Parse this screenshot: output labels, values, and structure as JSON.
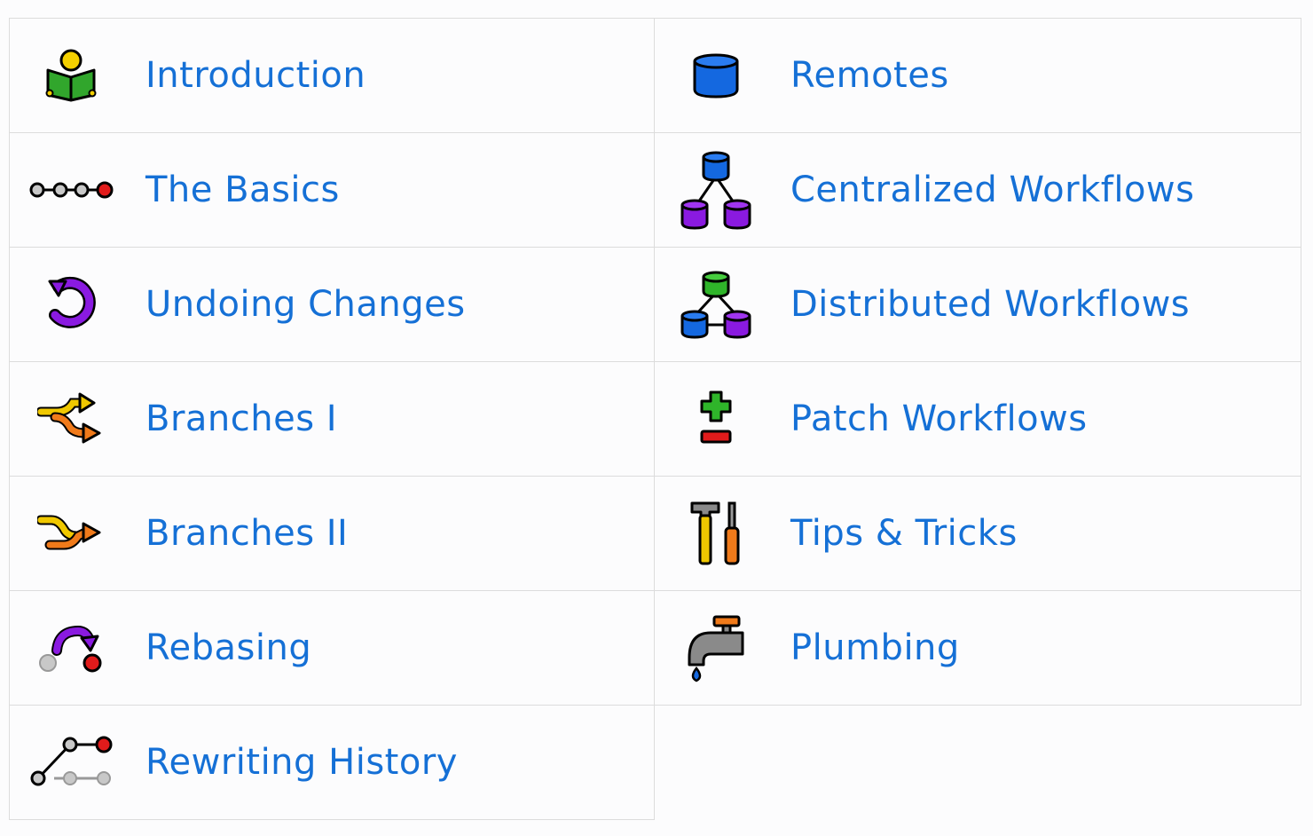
{
  "topics": {
    "introduction": {
      "label": "Introduction",
      "icon": "book-reader-icon"
    },
    "remotes": {
      "label": "Remotes",
      "icon": "database-icon"
    },
    "basics": {
      "label": "The Basics",
      "icon": "commit-chain-icon"
    },
    "centralized": {
      "label": "Centralized Workflows",
      "icon": "centralized-repos-icon"
    },
    "undoing": {
      "label": "Undoing Changes",
      "icon": "undo-icon"
    },
    "distributed": {
      "label": "Distributed Workflows",
      "icon": "distributed-repos-icon"
    },
    "branches1": {
      "label": "Branches I",
      "icon": "branch-arrows-icon"
    },
    "patch": {
      "label": "Patch Workflows",
      "icon": "plus-minus-icon"
    },
    "branches2": {
      "label": "Branches II",
      "icon": "merge-arrows-icon"
    },
    "tips": {
      "label": "Tips & Tricks",
      "icon": "tools-icon"
    },
    "rebasing": {
      "label": "Rebasing",
      "icon": "rebase-icon"
    },
    "plumbing": {
      "label": "Plumbing",
      "icon": "faucet-icon"
    },
    "rewriting": {
      "label": "Rewriting History",
      "icon": "history-graph-icon"
    }
  },
  "colors": {
    "link": "#1570d6",
    "border": "#dcdcdc",
    "background": "#fcfcfd"
  }
}
